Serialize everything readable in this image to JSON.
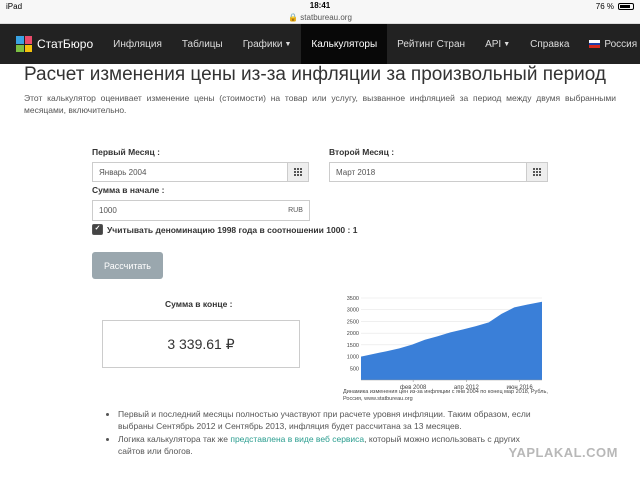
{
  "status_bar": {
    "device": "iPad",
    "time": "18:41",
    "battery": "76 %"
  },
  "browser": {
    "url": "statbureau.org"
  },
  "nav": {
    "brand": "СтатБюро",
    "items": [
      "Инфляция",
      "Таблицы",
      "Графики",
      "Калькуляторы",
      "Рейтинг Стран",
      "API",
      "Справка"
    ],
    "active": "Калькуляторы",
    "language": "Россия"
  },
  "page": {
    "title": "Расчет изменения цены из-за инфляции за произвольный период",
    "description": "Этот калькулятор оценивает изменение цены (стоимости) на товар или услугу, вызванное инфляцией за период между двумя выбранными месяцами, включительно."
  },
  "form": {
    "first_month_label": "Первый Месяц :",
    "first_month_value": "Январь 2004",
    "second_month_label": "Второй Месяц :",
    "second_month_value": "Март 2018",
    "start_sum_label": "Сумма в начале :",
    "start_sum_value": "1000",
    "currency": "RUB",
    "denomination_label": "Учитывать деноминацию 1998 года в соотношении 1000 : 1",
    "denomination_checked": true,
    "calculate_button": "Рассчитать"
  },
  "result": {
    "label": "Сумма в конце :",
    "value": "3 339.61 ₽"
  },
  "chart_data": {
    "type": "area",
    "x_tick_labels": [
      "фев 2008",
      "апр 2012",
      "июн 2016"
    ],
    "y_ticks": [
      500,
      1000,
      1500,
      2000,
      2500,
      3000,
      3500
    ],
    "ylim": [
      0,
      3500
    ],
    "x": [
      "2004-01",
      "2005-01",
      "2006-01",
      "2007-01",
      "2008-01",
      "2009-01",
      "2010-01",
      "2011-01",
      "2012-01",
      "2013-01",
      "2014-01",
      "2015-01",
      "2016-01",
      "2017-01",
      "2018-03"
    ],
    "values": [
      1000,
      1115,
      1230,
      1350,
      1510,
      1720,
      1870,
      2030,
      2160,
      2300,
      2460,
      2820,
      3100,
      3220,
      3340
    ],
    "color": "#3a7fd8",
    "caption": "Динамика изменения цен из-за инфляции с янв 2004 по конец мар 2018, Рубль, Россия, www.statbureau.org"
  },
  "notes": {
    "item1": "Первый и последний месяцы полностью участвуют при расчете уровня инфляции. Таким образом, если выбраны Сентябрь 2012 и Сентябрь 2013, инфляция будет рассчитана за 13 месяцев.",
    "item2_before": "Логика калькулятора так же ",
    "item2_link": "представлена в виде веб сервиса",
    "item2_after": ", который можно использовать с других сайтов или блогов."
  },
  "watermark": "YAPLAKAL.COM"
}
